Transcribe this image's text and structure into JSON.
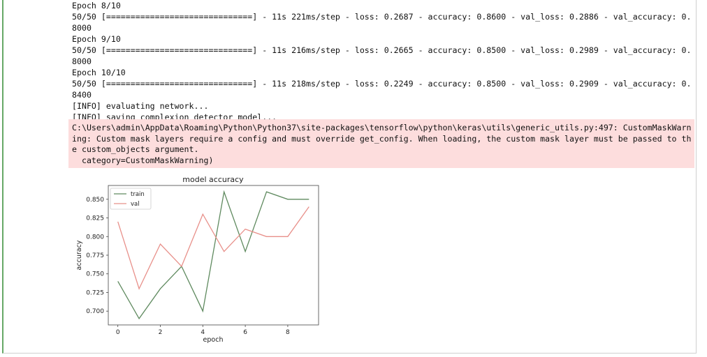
{
  "output": {
    "stream_lines": [
      "Epoch 8/10",
      "50/50 [==============================] - 11s 221ms/step - loss: 0.2687 - accuracy: 0.8600 - val_loss: 0.2886 - val_accuracy: 0.",
      "8000",
      "Epoch 9/10",
      "50/50 [==============================] - 11s 216ms/step - loss: 0.2665 - accuracy: 0.8500 - val_loss: 0.2989 - val_accuracy: 0.",
      "8000",
      "Epoch 10/10",
      "50/50 [==============================] - 11s 218ms/step - loss: 0.2249 - accuracy: 0.8500 - val_loss: 0.2909 - val_accuracy: 0.",
      "8400",
      "[INFO] evaluating network...",
      "[INFO] saving complexion detector model..."
    ],
    "warning_lines": [
      "C:\\Users\\admin\\AppData\\Roaming\\Python\\Python37\\site-packages\\tensorflow\\python\\keras\\utils\\generic_utils.py:497: CustomMaskWarn",
      "ing: Custom mask layers require a config and must override get_config. When loading, the custom mask layer must be passed to th",
      "e custom_objects argument.",
      "  category=CustomMaskWarning)"
    ]
  },
  "colors": {
    "train": "#5f8a5f",
    "val": "#e8908a",
    "warning_bg": "#fddddd",
    "cell_border": "#66a866"
  },
  "chart_data": {
    "type": "line",
    "title": "model accuracy",
    "xlabel": "epoch",
    "ylabel": "accuracy",
    "x": [
      0,
      1,
      2,
      3,
      4,
      5,
      6,
      7,
      8,
      9
    ],
    "series": [
      {
        "name": "train",
        "values": [
          0.74,
          0.69,
          0.73,
          0.76,
          0.7,
          0.86,
          0.78,
          0.86,
          0.85,
          0.85
        ]
      },
      {
        "name": "val",
        "values": [
          0.82,
          0.73,
          0.79,
          0.76,
          0.83,
          0.78,
          0.81,
          0.8,
          0.8,
          0.84
        ]
      }
    ],
    "xticks": [
      "0",
      "2",
      "4",
      "6",
      "8"
    ],
    "yticks": [
      "0.700",
      "0.725",
      "0.750",
      "0.775",
      "0.800",
      "0.825",
      "0.850"
    ],
    "xlim": [
      -0.45,
      9.45
    ],
    "ylim": [
      0.6815,
      0.8685
    ],
    "legend": "top-left",
    "grid": false
  }
}
